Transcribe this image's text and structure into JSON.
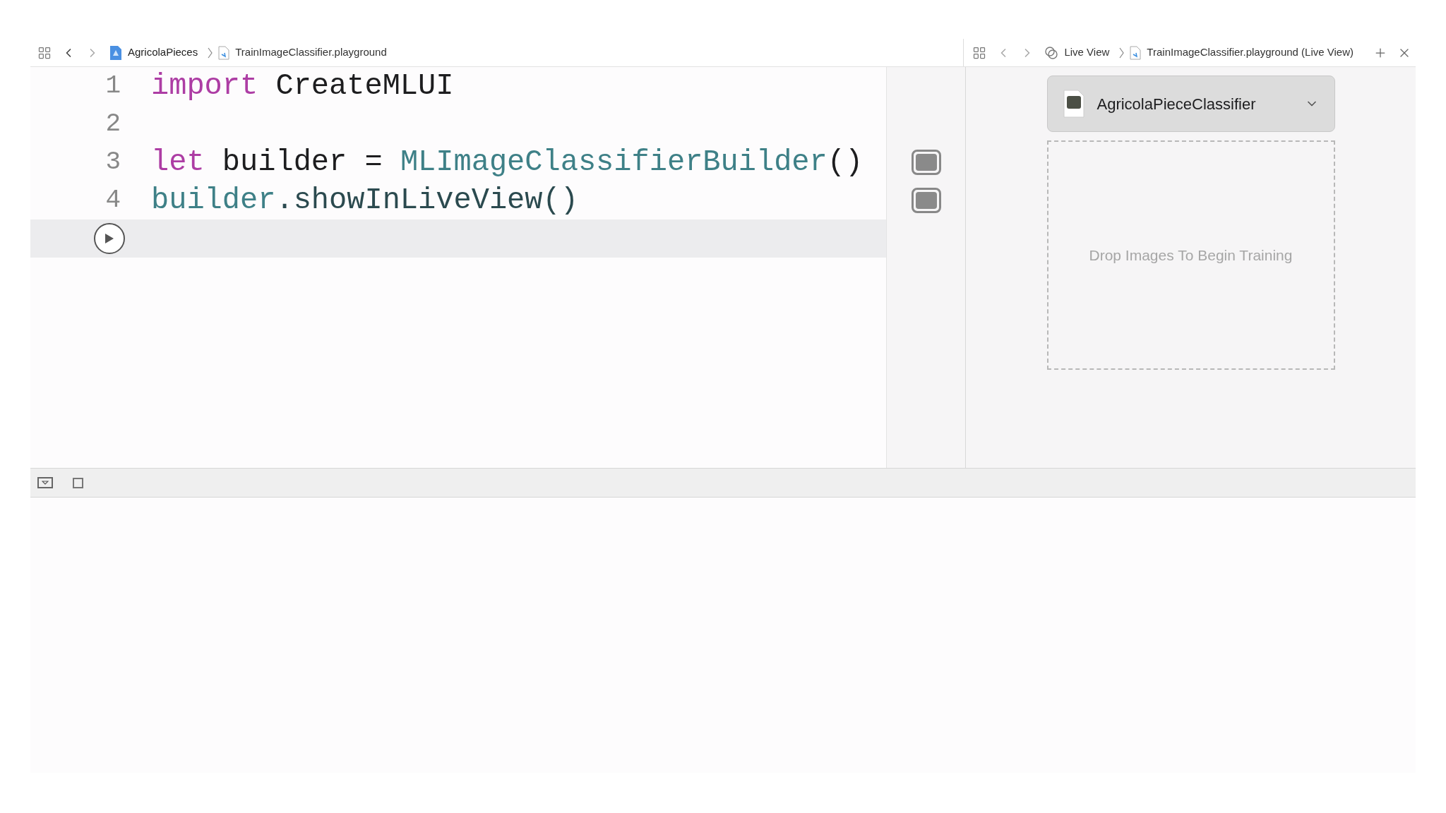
{
  "editor": {
    "breadcrumbs": [
      {
        "label": "AgricolaPieces",
        "kind": "project"
      },
      {
        "label": "TrainImageClassifier.playground",
        "kind": "file"
      }
    ],
    "lines": [
      {
        "number": "1",
        "result_shown": false,
        "tokens": [
          {
            "text": "import",
            "kind": "keyword"
          },
          {
            "text": " CreateMLUI",
            "kind": "plain"
          }
        ]
      },
      {
        "number": "2",
        "result_shown": false
      },
      {
        "number": "3",
        "result_shown": true,
        "tokens": [
          {
            "text": "let",
            "kind": "keyword"
          },
          {
            "text": " builder = ",
            "kind": "plain"
          },
          {
            "text": "MLImageClassifierBuilder",
            "kind": "type"
          },
          {
            "text": "()",
            "kind": "plain"
          }
        ]
      },
      {
        "number": "4",
        "result_shown": true,
        "tokens": [
          {
            "text": "builder",
            "kind": "type"
          },
          {
            "text": ".showInLiveView()",
            "kind": "member"
          }
        ]
      }
    ]
  },
  "live_view": {
    "breadcrumbs": [
      {
        "label": "Live View",
        "kind": "liveview"
      },
      {
        "label": "TrainImageClassifier.playground (Live View)",
        "kind": "file"
      }
    ],
    "model": {
      "name": "AgricolaPieceClassifier"
    },
    "drop_zone": {
      "text": "Drop Images To Begin Training"
    }
  }
}
